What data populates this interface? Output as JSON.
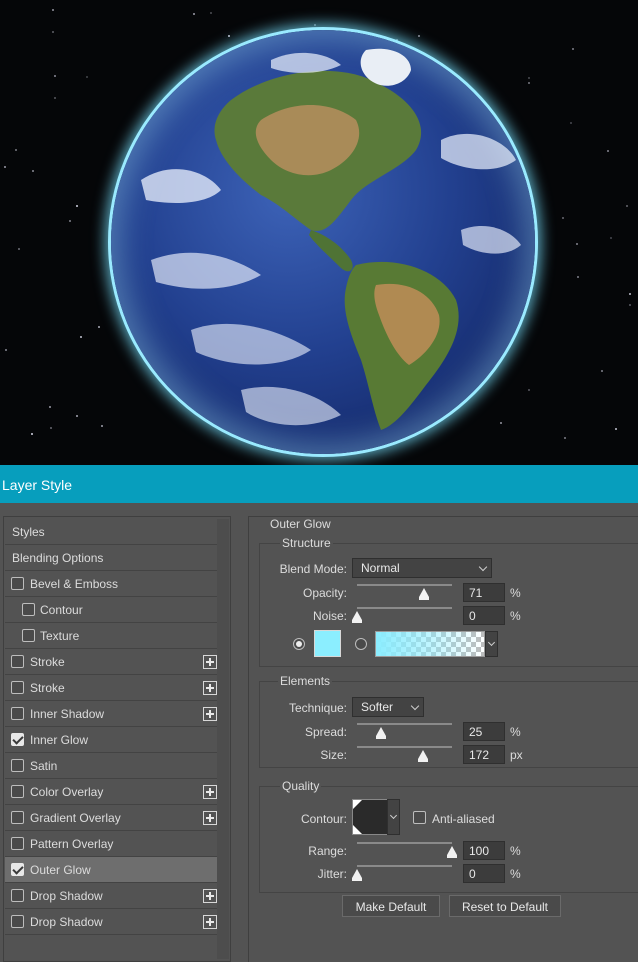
{
  "title_bar": {
    "title": "Layer Style"
  },
  "left_panel": {
    "items": [
      {
        "label": "Styles",
        "checkbox": false,
        "checked": false,
        "indent": false,
        "plus": false,
        "selected": false
      },
      {
        "label": "Blending Options",
        "checkbox": false,
        "checked": false,
        "indent": false,
        "plus": false,
        "selected": false
      },
      {
        "label": "Bevel & Emboss",
        "checkbox": true,
        "checked": false,
        "indent": false,
        "plus": false,
        "selected": false
      },
      {
        "label": "Contour",
        "checkbox": true,
        "checked": false,
        "indent": true,
        "plus": false,
        "selected": false
      },
      {
        "label": "Texture",
        "checkbox": true,
        "checked": false,
        "indent": true,
        "plus": false,
        "selected": false
      },
      {
        "label": "Stroke",
        "checkbox": true,
        "checked": false,
        "indent": false,
        "plus": true,
        "selected": false
      },
      {
        "label": "Stroke",
        "checkbox": true,
        "checked": false,
        "indent": false,
        "plus": true,
        "selected": false
      },
      {
        "label": "Inner Shadow",
        "checkbox": true,
        "checked": false,
        "indent": false,
        "plus": true,
        "selected": false
      },
      {
        "label": "Inner Glow",
        "checkbox": true,
        "checked": true,
        "indent": false,
        "plus": false,
        "selected": false
      },
      {
        "label": "Satin",
        "checkbox": true,
        "checked": false,
        "indent": false,
        "plus": false,
        "selected": false
      },
      {
        "label": "Color Overlay",
        "checkbox": true,
        "checked": false,
        "indent": false,
        "plus": true,
        "selected": false
      },
      {
        "label": "Gradient Overlay",
        "checkbox": true,
        "checked": false,
        "indent": false,
        "plus": true,
        "selected": false
      },
      {
        "label": "Pattern Overlay",
        "checkbox": true,
        "checked": false,
        "indent": false,
        "plus": false,
        "selected": false
      },
      {
        "label": "Outer Glow",
        "checkbox": true,
        "checked": true,
        "indent": false,
        "plus": false,
        "selected": true
      },
      {
        "label": "Drop Shadow",
        "checkbox": true,
        "checked": false,
        "indent": false,
        "plus": true,
        "selected": false
      },
      {
        "label": "Drop Shadow",
        "checkbox": true,
        "checked": false,
        "indent": false,
        "plus": true,
        "selected": false
      }
    ]
  },
  "outer_glow": {
    "heading": "Outer Glow",
    "structure": {
      "heading": "Structure",
      "blend_mode_label": "Blend Mode:",
      "blend_mode_value": "Normal",
      "opacity_label": "Opacity:",
      "opacity_value": "71",
      "opacity_unit": "%",
      "opacity_fraction": 0.71,
      "noise_label": "Noise:",
      "noise_value": "0",
      "noise_unit": "%",
      "noise_fraction": 0.0,
      "glow_color": "#8beeff",
      "color_mode": "solid"
    },
    "elements": {
      "heading": "Elements",
      "technique_label": "Technique:",
      "technique_value": "Softer",
      "spread_label": "Spread:",
      "spread_value": "25",
      "spread_unit": "%",
      "spread_fraction": 0.25,
      "size_label": "Size:",
      "size_value": "172",
      "size_unit": "px",
      "size_fraction": 0.69
    },
    "quality": {
      "heading": "Quality",
      "contour_label": "Contour:",
      "anti_aliased_label": "Anti-aliased",
      "anti_aliased": false,
      "range_label": "Range:",
      "range_value": "100",
      "range_unit": "%",
      "range_fraction": 1.0,
      "jitter_label": "Jitter:",
      "jitter_value": "0",
      "jitter_unit": "%",
      "jitter_fraction": 0.0
    },
    "buttons": {
      "make_default": "Make Default",
      "reset_default": "Reset to Default"
    }
  },
  "colors": {
    "title_bar": "#079ebd",
    "panel": "#535353",
    "glow": "#8beeff"
  }
}
